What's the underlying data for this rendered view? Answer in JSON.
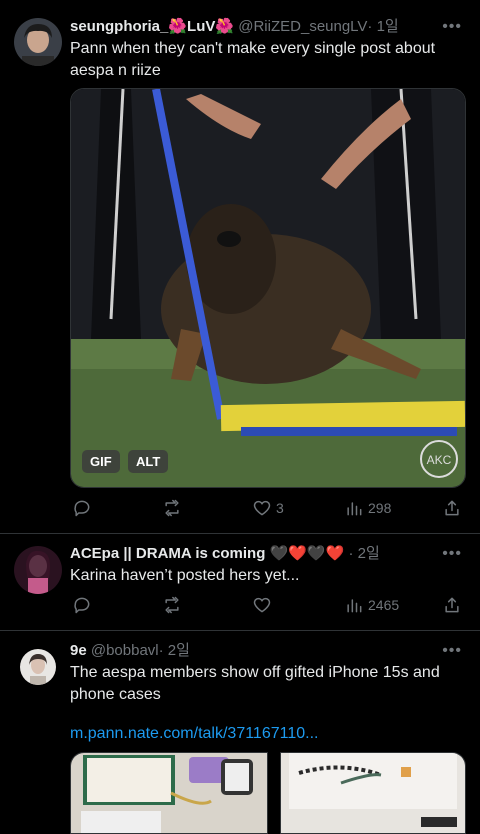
{
  "tweets": [
    {
      "author": "seungphoria_",
      "author_suffix": "LuV",
      "handle": "@RiiZED_seungLV",
      "time": "· 1일",
      "text": "Pann when they can't make every single post about aespa n riize",
      "media_badges": [
        "GIF",
        "ALT"
      ],
      "replies": "",
      "retweets": "",
      "likes": "3",
      "views": "298"
    },
    {
      "author": "ACEpa || DRAMA is coming",
      "handle": "",
      "time": "· 2일",
      "text": "Karina haven’t posted hers yet...",
      "replies": "",
      "retweets": "",
      "likes": "",
      "views": "2465"
    },
    {
      "author": "9e",
      "handle": "@bobbavl",
      "time": "· 2일",
      "text": "The aespa members show off gifted iPhone 15s and phone cases",
      "link": "m.pann.nate.com/talk/371167110..."
    }
  ],
  "more_label": "•••",
  "colors": {
    "accent": "#1d9bf0",
    "muted": "#71767b",
    "divider": "#2f3336",
    "background": "#000000"
  },
  "icons": [
    "reply-icon",
    "retweet-icon",
    "like-icon",
    "views-icon",
    "share-icon",
    "more-icon"
  ]
}
